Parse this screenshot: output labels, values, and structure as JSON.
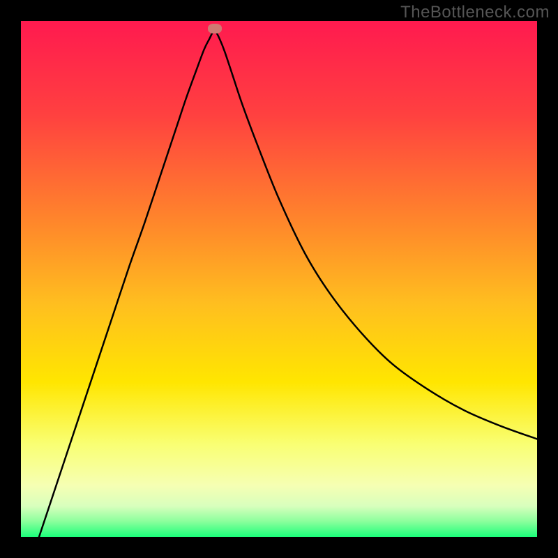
{
  "watermark": "TheBottleneck.com",
  "chart_data": {
    "type": "line",
    "title": "",
    "xlabel": "",
    "ylabel": "",
    "xlim": [
      0,
      1
    ],
    "ylim": [
      0,
      1
    ],
    "grid": false,
    "background_gradient": {
      "type": "vertical",
      "stops": [
        {
          "offset": 0.0,
          "color": "#ff1a4f"
        },
        {
          "offset": 0.18,
          "color": "#ff4040"
        },
        {
          "offset": 0.4,
          "color": "#ff8a2a"
        },
        {
          "offset": 0.55,
          "color": "#ffbf1f"
        },
        {
          "offset": 0.7,
          "color": "#ffe600"
        },
        {
          "offset": 0.82,
          "color": "#f9ff73"
        },
        {
          "offset": 0.9,
          "color": "#f6ffb3"
        },
        {
          "offset": 0.94,
          "color": "#d8ffbd"
        },
        {
          "offset": 0.97,
          "color": "#8aff9c"
        },
        {
          "offset": 1.0,
          "color": "#1aff7a"
        }
      ]
    },
    "marker": {
      "x": 0.375,
      "y": 0.985,
      "color": "#cf7a73"
    },
    "series": [
      {
        "name": "curve",
        "color": "#000000",
        "x": [
          0.035,
          0.06,
          0.09,
          0.12,
          0.15,
          0.18,
          0.21,
          0.24,
          0.27,
          0.3,
          0.32,
          0.34,
          0.355,
          0.365,
          0.372,
          0.378,
          0.385,
          0.395,
          0.41,
          0.43,
          0.46,
          0.5,
          0.55,
          0.6,
          0.66,
          0.72,
          0.79,
          0.86,
          0.93,
          1.0
        ],
        "y": [
          0.0,
          0.075,
          0.165,
          0.255,
          0.345,
          0.435,
          0.525,
          0.61,
          0.7,
          0.79,
          0.85,
          0.905,
          0.945,
          0.965,
          0.978,
          0.978,
          0.965,
          0.94,
          0.895,
          0.835,
          0.755,
          0.655,
          0.55,
          0.47,
          0.395,
          0.335,
          0.285,
          0.245,
          0.215,
          0.19
        ]
      }
    ]
  }
}
